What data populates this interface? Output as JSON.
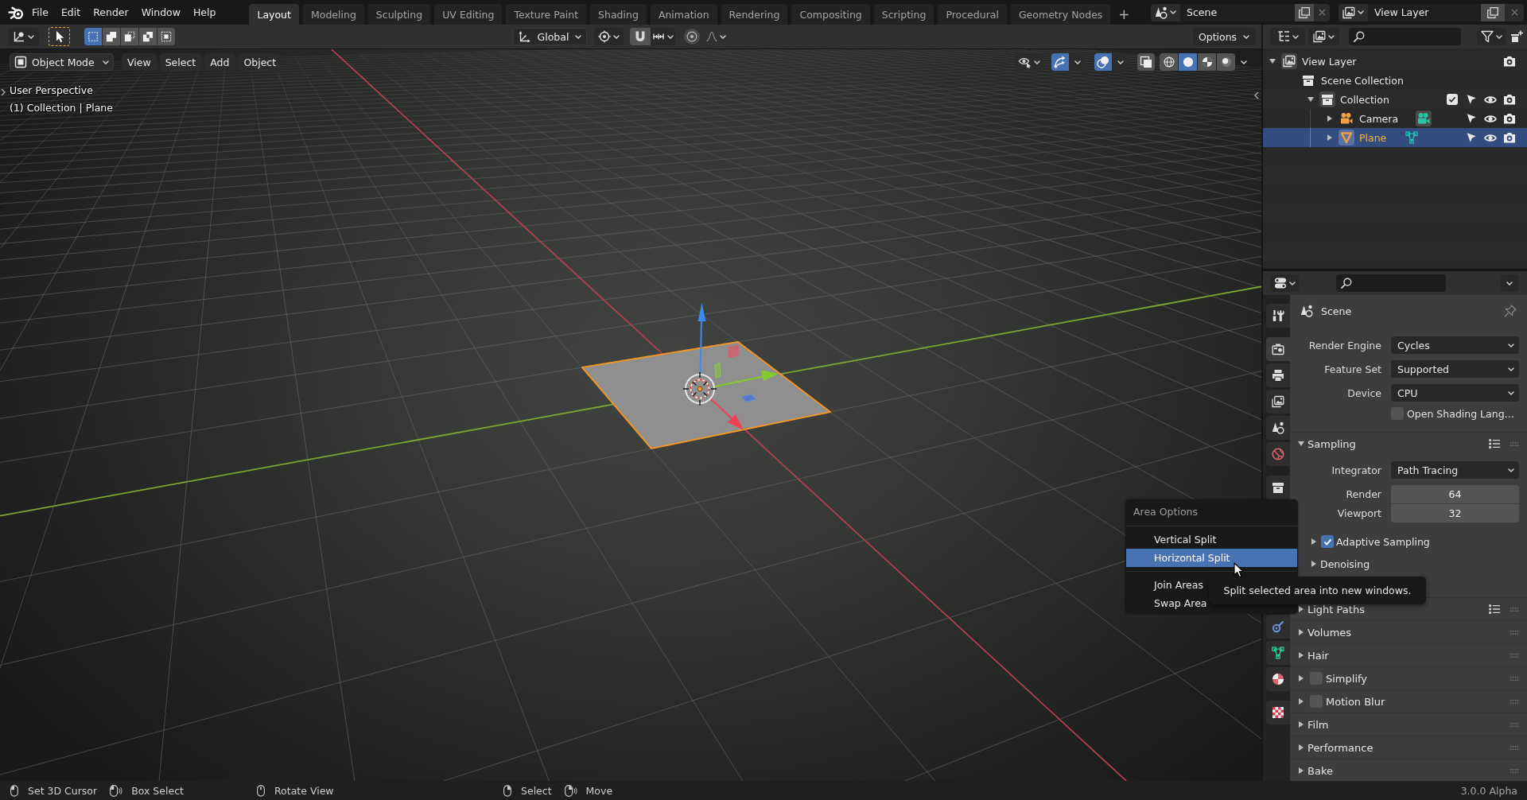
{
  "topbar": {
    "menus": [
      "File",
      "Edit",
      "Render",
      "Window",
      "Help"
    ],
    "workspaces": [
      {
        "label": "Layout",
        "selected": true
      },
      {
        "label": "Modeling",
        "selected": false
      },
      {
        "label": "Sculpting",
        "selected": false
      },
      {
        "label": "UV Editing",
        "selected": false
      },
      {
        "label": "Texture Paint",
        "selected": false
      },
      {
        "label": "Shading",
        "selected": false
      },
      {
        "label": "Animation",
        "selected": false
      },
      {
        "label": "Rendering",
        "selected": false
      },
      {
        "label": "Compositing",
        "selected": false
      },
      {
        "label": "Scripting",
        "selected": false
      },
      {
        "label": "Procedural",
        "selected": false
      },
      {
        "label": "Geometry Nodes",
        "selected": false
      }
    ],
    "add_workspace": "+",
    "scene": "Scene",
    "view_layer": "View Layer"
  },
  "tool_header": {
    "select_modes": [
      {
        "kind": "set",
        "selected": true
      },
      {
        "kind": "extend",
        "selected": false
      },
      {
        "kind": "subtract",
        "selected": false
      },
      {
        "kind": "difference",
        "selected": false
      },
      {
        "kind": "intersect",
        "selected": false
      }
    ],
    "orientation": "Global",
    "options": "Options"
  },
  "viewport": {
    "mode": "Object Mode",
    "menus": [
      "View",
      "Select",
      "Add",
      "Object"
    ],
    "overlay_toggles": [
      {
        "kind": "gizmos",
        "on": true
      },
      {
        "kind": "overlays",
        "on": true
      },
      {
        "kind": "xray",
        "on": false
      }
    ],
    "shading": [
      {
        "kind": "wireframe",
        "selected": false
      },
      {
        "kind": "solid",
        "selected": true
      },
      {
        "kind": "material",
        "selected": false
      },
      {
        "kind": "rendered",
        "selected": false
      }
    ],
    "view_name": "User Perspective",
    "context": "(1) Collection | Plane"
  },
  "outliner": {
    "tree": [
      {
        "label": "View Layer",
        "kind": "view_layer",
        "expanded": true,
        "selected": false,
        "toggles": [
          {
            "kind": "render",
            "on": true
          }
        ],
        "children": [
          {
            "label": "Scene Collection",
            "kind": "scene_collection",
            "selected": false,
            "children": [
              {
                "label": "Collection",
                "kind": "collection",
                "expanded": true,
                "selected": false,
                "toggles": [
                  {
                    "kind": "include",
                    "on": true
                  },
                  {
                    "kind": "select",
                    "on": true
                  },
                  {
                    "kind": "visibility",
                    "on": true
                  },
                  {
                    "kind": "render",
                    "on": true
                  }
                ],
                "children": [
                  {
                    "label": "Camera",
                    "kind": "camera",
                    "expanded": false,
                    "selected": false,
                    "toggles": [
                      {
                        "kind": "select",
                        "on": true
                      },
                      {
                        "kind": "visibility",
                        "on": true
                      },
                      {
                        "kind": "render",
                        "on": true
                      }
                    ]
                  },
                  {
                    "label": "Plane",
                    "kind": "mesh",
                    "expanded": false,
                    "selected": true,
                    "toggles": [
                      {
                        "kind": "select",
                        "on": true
                      },
                      {
                        "kind": "visibility",
                        "on": true
                      },
                      {
                        "kind": "render",
                        "on": true
                      }
                    ]
                  }
                ]
              }
            ]
          }
        ]
      }
    ]
  },
  "properties": {
    "tabs": [
      [
        {
          "kind": "tool",
          "selected": false
        }
      ],
      [
        {
          "kind": "render",
          "selected": true
        },
        {
          "kind": "output",
          "selected": false
        },
        {
          "kind": "view_layer",
          "selected": false
        },
        {
          "kind": "scene",
          "selected": false
        },
        {
          "kind": "world",
          "selected": false
        }
      ],
      [
        {
          "kind": "collection",
          "selected": false
        }
      ],
      [
        {
          "kind": "constraints",
          "selected": false
        },
        {
          "kind": "data",
          "selected": false
        },
        {
          "kind": "material",
          "selected": false
        }
      ],
      [
        {
          "kind": "texture",
          "selected": false
        }
      ]
    ],
    "context": "Scene",
    "settings": [
      {
        "kind": "dropdown",
        "label": "Render Engine",
        "value": "Cycles"
      },
      {
        "kind": "dropdown",
        "label": "Feature Set",
        "value": "Supported"
      },
      {
        "kind": "dropdown",
        "label": "Device",
        "value": "CPU"
      },
      {
        "kind": "checkbox",
        "label": "Open Shading Lang…",
        "checked": false
      }
    ],
    "panels": [
      {
        "label": "Sampling",
        "expanded": true,
        "presets": true,
        "settings": [
          {
            "kind": "dropdown",
            "label": "Integrator",
            "value": "Path Tracing"
          },
          {
            "kind": "number",
            "label": "Render",
            "value": "64"
          },
          {
            "kind": "number",
            "label": "Viewport",
            "value": "32"
          }
        ],
        "subpanels": [
          {
            "label": "Adaptive Sampling",
            "expanded": false,
            "checked": true
          },
          {
            "label": "Denoising",
            "expanded": false
          }
        ]
      },
      {
        "label": "Light Paths",
        "expanded": false,
        "presets": true
      },
      {
        "label": "Volumes",
        "expanded": false
      },
      {
        "label": "Hair",
        "expanded": false
      },
      {
        "label": "Simplify",
        "expanded": false,
        "checked": false
      },
      {
        "label": "Motion Blur",
        "expanded": false,
        "checked": false
      },
      {
        "label": "Film",
        "expanded": false
      },
      {
        "label": "Performance",
        "expanded": false
      },
      {
        "label": "Bake",
        "expanded": false
      }
    ]
  },
  "area_menu": {
    "title": "Area Options",
    "groups": [
      [
        {
          "label": "Vertical Split",
          "selected": false
        },
        {
          "label": "Horizontal Split",
          "selected": true
        }
      ],
      [
        {
          "label": "Join Areas",
          "selected": false
        },
        {
          "label": "Swap Area",
          "selected": false
        }
      ]
    ]
  },
  "tooltip": "Split selected area into new windows.",
  "status_bar": {
    "groups": [
      [
        {
          "kind": "mouse_left",
          "label": "Set 3D Cursor"
        },
        {
          "kind": "mouse_left_drag",
          "label": "Box Select"
        }
      ],
      [
        {
          "kind": "mouse_middle",
          "label": "Rotate View"
        }
      ],
      [
        {
          "kind": "mouse_right",
          "label": "Select"
        },
        {
          "kind": "mouse_right_drag",
          "label": "Move"
        }
      ]
    ],
    "version": "3.0.0 Alpha"
  }
}
